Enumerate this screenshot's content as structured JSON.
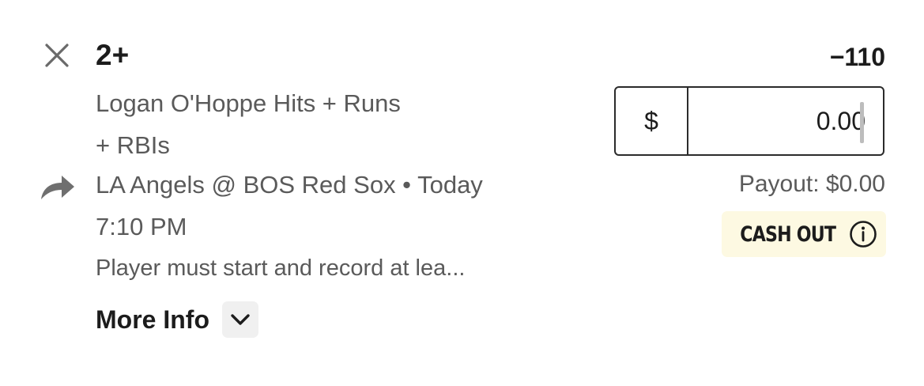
{
  "bet": {
    "selection": "2+",
    "market_line1": "Logan O'Hoppe Hits + Runs",
    "market_line2": "+ RBIs",
    "event_line1": "LA Angels @ BOS Red Sox • Today",
    "event_line2": "7:10 PM",
    "description": "Player must start and record at lea...",
    "more_info_label": "More Info",
    "odds": "−110"
  },
  "stake": {
    "currency_symbol": "$",
    "value": "0.00"
  },
  "payout": {
    "text": "Payout: $0.00"
  },
  "cashout": {
    "label": "CASH OUT"
  },
  "icons": {
    "close": "close-icon",
    "share": "share-arrow-icon",
    "chevron": "chevron-down-icon",
    "info": "info-icon"
  },
  "colors": {
    "text_primary": "#1c1c1c",
    "text_secondary": "#5a5a5a",
    "cashout_bg": "#fdf9e2",
    "chevron_bg": "#f0f0f0"
  }
}
